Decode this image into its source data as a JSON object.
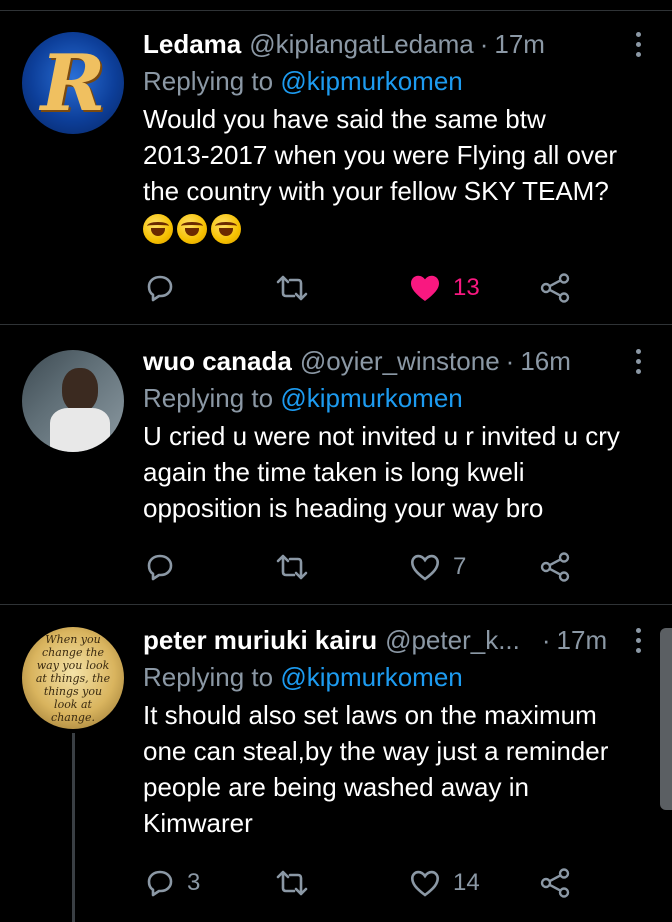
{
  "colors": {
    "background": "#000000",
    "divider": "#2f3336",
    "secondary_text": "#8b98a5",
    "link": "#1d9bf0",
    "like_active": "#f91880"
  },
  "tweets": [
    {
      "display_name": "Ledama",
      "handle": "@kiplangatLedama",
      "time": "17m",
      "replying_prefix": "Replying to",
      "replying_to": "@kipmurkomen",
      "body_lines": [
        "Would you have said the same btw",
        "2013-2017 when you were Flying all over",
        "the country with your fellow SKY TEAM?"
      ],
      "emoji": [
        "rolling-on-floor-laughing",
        "rolling-on-floor-laughing",
        "rolling-on-floor-laughing"
      ],
      "avatar_icon": "letter-r-logo",
      "avatar_letter": "R",
      "reply_count": "",
      "retweet_count": "",
      "like_count": "13",
      "liked": true
    },
    {
      "display_name": "wuo canada",
      "handle": "@oyier_winstone",
      "time": "16m",
      "replying_prefix": "Replying to",
      "replying_to": "@kipmurkomen",
      "body_lines": [
        "U cried u were not invited u r invited u cry",
        "again the time taken is long kweli",
        "opposition is heading your way bro"
      ],
      "avatar_icon": "profile-photo",
      "reply_count": "",
      "retweet_count": "",
      "like_count": "7",
      "liked": false
    },
    {
      "display_name": "peter muriuki kairu",
      "handle": "@peter_k...",
      "time": "17m",
      "replying_prefix": "Replying to",
      "replying_to": "@kipmurkomen",
      "body_lines": [
        "It should also set laws on the maximum",
        "one can steal,by the way just a reminder",
        "people are being washed away in",
        "Kimwarer"
      ],
      "avatar_icon": "quote-image",
      "avatar_quote": "When you change the way you look at things, the things you look at change.",
      "reply_count": "3",
      "retweet_count": "",
      "like_count": "14",
      "liked": false
    }
  ]
}
